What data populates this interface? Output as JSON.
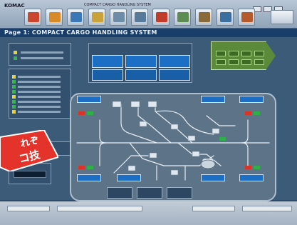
{
  "app": {
    "name": "KOMAC",
    "window_title": "COMPACT CARGO HANDLING SYSTEM"
  },
  "screen": {
    "title": "Page 1: COMPACT CARGO HANDLING SYSTEM"
  },
  "toolbar": {
    "buttons": [
      {
        "icon": "truck-icon",
        "color": "#c8472e"
      },
      {
        "icon": "crane-icon",
        "color": "#d88a2a"
      },
      {
        "icon": "conveyor-icon",
        "color": "#3b78b8"
      },
      {
        "icon": "forklift-icon",
        "color": "#c9a23a"
      },
      {
        "icon": "warehouse-icon",
        "color": "#6d8ca8"
      },
      {
        "icon": "camera-icon",
        "color": "#587a9a"
      },
      {
        "icon": "container-icon",
        "color": "#c23b2b"
      },
      {
        "icon": "map-icon",
        "color": "#5c8c52"
      },
      {
        "icon": "tools-icon",
        "color": "#8a6a3a"
      },
      {
        "icon": "chart-icon",
        "color": "#3c6fa0"
      },
      {
        "icon": "help-icon",
        "color": "#b45a2c"
      }
    ]
  },
  "panels": {
    "status_items": [
      {
        "color": "#e6d23a"
      },
      {
        "color": "#3ab54a"
      },
      {
        "color": "#3ab54a"
      },
      {
        "color": "#3ab54a"
      },
      {
        "color": "#e6d23a"
      },
      {
        "color": "#3ab54a"
      },
      {
        "color": "#3ab54a"
      },
      {
        "color": "#e6d23a"
      }
    ]
  },
  "sticker": {
    "text_top": "れぞ",
    "text_bottom": "コ技",
    "color": "#e4332a"
  },
  "colors": {
    "unit_blue": "#1c6fc4",
    "tag_red": "#d8342a",
    "tag_green": "#2fae4a",
    "route_line": "#e8eef4"
  }
}
